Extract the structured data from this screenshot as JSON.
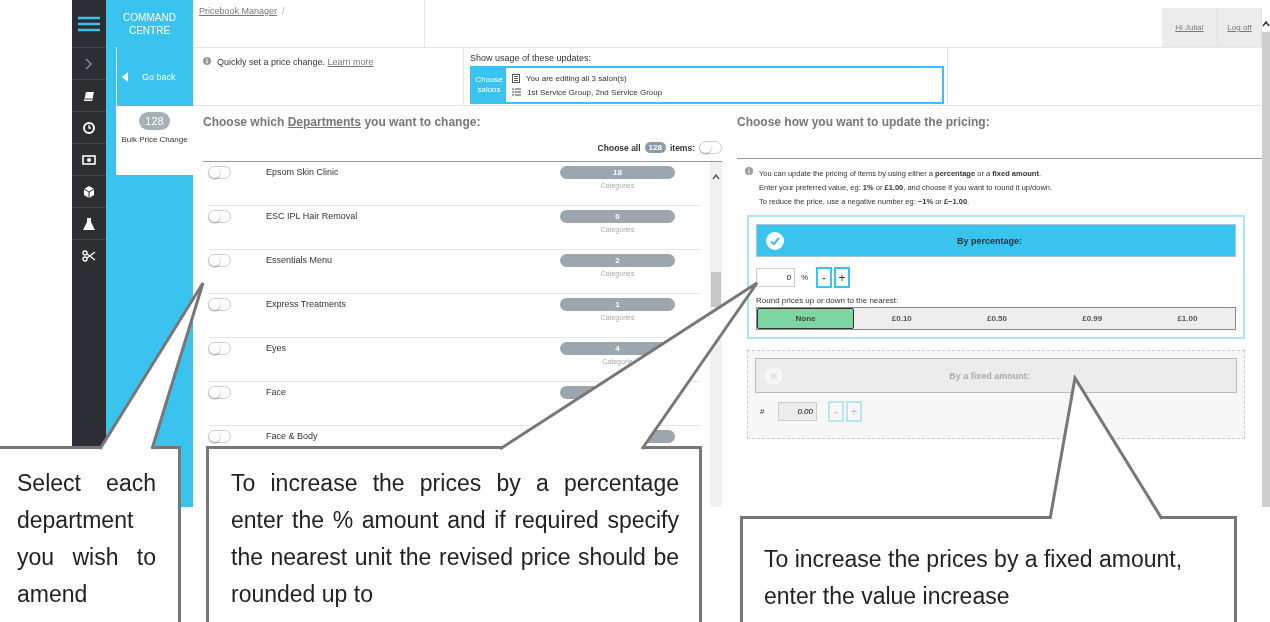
{
  "brand": "COMMAND CENTRE",
  "breadcrumb": {
    "link": "Pricebook Manager",
    "separator": "/"
  },
  "user": {
    "greeting": "Hi Julia!",
    "logout": "Log off"
  },
  "back_button": "Go back",
  "info": {
    "text": "Quickly set a price change.",
    "link": "Learn more"
  },
  "usage": {
    "title": "Show usage of these updates:",
    "button": "Choose salons",
    "salons": "You are editing all 3 salon(s)",
    "groups": "1st Service Group, 2nd Service Group"
  },
  "tool": {
    "count": "128",
    "label": "Bulk Price Change"
  },
  "departments": {
    "heading_start": "Choose which",
    "heading_link": "Departments",
    "heading_end": "you want to change:",
    "choose_all": {
      "label": "Choose all",
      "count": "128",
      "suffix": "items:",
      "on": false
    },
    "rows": [
      {
        "name": "Epsom Skin Clinic",
        "on": false,
        "count": "18",
        "unit": "Categories"
      },
      {
        "name": "ESC IPL Hair Removal",
        "on": false,
        "count": "0",
        "unit": "Categories"
      },
      {
        "name": "Essentials Menu",
        "on": false,
        "count": "2",
        "unit": "Categories"
      },
      {
        "name": "Express Treatments",
        "on": false,
        "count": "1",
        "unit": "Categories"
      },
      {
        "name": "Eyes",
        "on": false,
        "count": "4",
        "unit": "Categorie"
      },
      {
        "name": "Face",
        "on": false
      },
      {
        "name": "Face & Body",
        "on": false
      }
    ]
  },
  "pricing": {
    "heading": "Choose how you want to update the pricing:",
    "notes": [
      "You can update the pricing of items by using either a **percentage** or a **fixed amount**.",
      "Enter your preferred value, eg: **1%** or **£1.00**, and choose if you want to round it up/down.",
      "To reduce the price, use a negative number eg: **−1%** or **£−1.00**."
    ],
    "percentage": {
      "title": "By percentage:",
      "selected": true,
      "value": "0",
      "unit": "%",
      "minus": "-",
      "plus": "+",
      "round_label": "Round prices up or down to the nearest:",
      "round_options": [
        {
          "label": "None",
          "selected": true
        },
        {
          "label": "£0.10",
          "selected": false
        },
        {
          "label": "£0.50",
          "selected": false
        },
        {
          "label": "£0.99",
          "selected": false
        },
        {
          "label": "£1.00",
          "selected": false
        }
      ]
    },
    "fixed": {
      "title": "By a fixed amount:",
      "selected": false,
      "unit": "#",
      "value": "0.00",
      "minus": "-",
      "plus": "+"
    }
  },
  "callouts": [
    {
      "text": "Select each department you wish to amend"
    },
    {
      "text": "To increase the prices by a percentage enter the % amount and if required specify the nearest unit the revised price should be rounded up to"
    },
    {
      "text": "To increase the prices by a fixed amount, enter the value increase"
    }
  ]
}
